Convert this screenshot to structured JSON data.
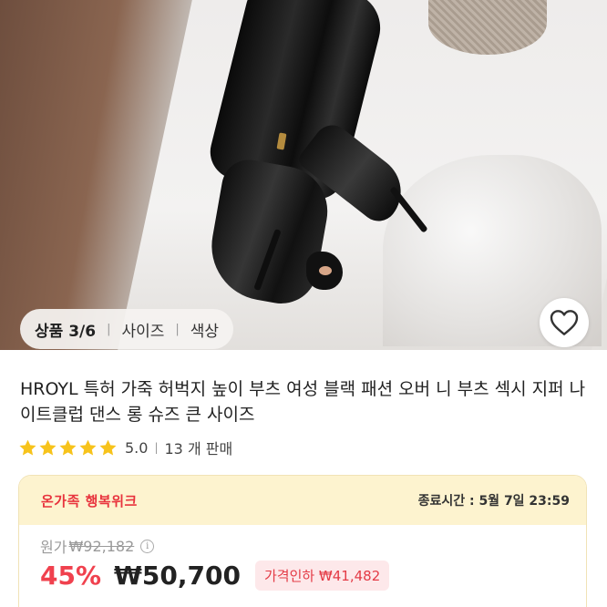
{
  "image_chips": {
    "counter": "상품 3/6",
    "size": "사이즈",
    "color": "색상"
  },
  "product": {
    "title": "HROYL 특허 가죽 허벅지 높이 부츠 여성 블랙 패션 오버 니 부츠 섹시 지퍼 나이트클럽 댄스 롱 슈즈 큰 사이즈",
    "rating": "5.0",
    "sold": "13 개 판매",
    "stars": 5
  },
  "promo": {
    "name": "온가족 행복위크",
    "ends": "종료시간 : 5월 7일 23:59",
    "original_label": "원가",
    "original_price": "₩92,182",
    "discount": "45%",
    "price": "₩50,700",
    "price_drop": "가격인하 ₩41,482"
  },
  "colors": {
    "accent_red": "#f0414e",
    "star_yellow": "#f7c31b",
    "promo_bg": "#fdf3cf"
  },
  "icons": {
    "wishlist": "heart-outline-icon",
    "star": "star-icon",
    "info": "info-icon"
  }
}
